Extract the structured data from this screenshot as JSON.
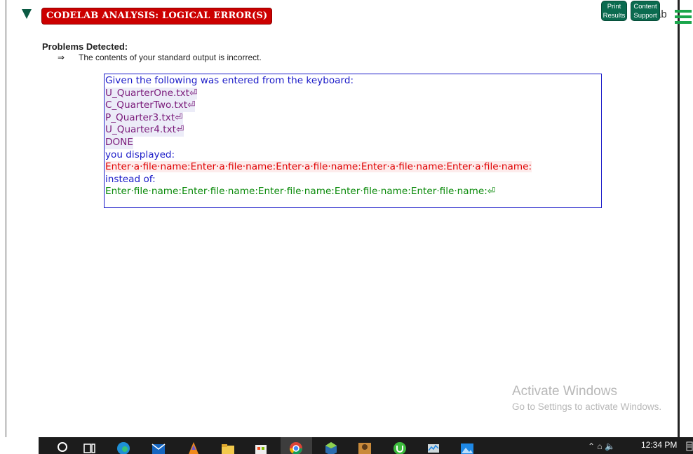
{
  "header": {
    "banner_label": "CODELAB ANALYSIS: LOGICAL ERROR(S)",
    "print_results_line1": "Print",
    "print_results_line2": "Results",
    "content_support_line1": "Content",
    "content_support_line2": "Support",
    "behind_text": "ab"
  },
  "problems": {
    "heading": "Problems Detected:",
    "arrow": "⇒",
    "items": [
      "The contents of your standard output is incorrect."
    ]
  },
  "output": {
    "intro": "Given the following was entered from the keyboard:",
    "inputs": [
      "U_QuarterOne.txt⏎",
      "C_QuarterTwo.txt⏎",
      "P_Quarter3.txt⏎",
      "U_Quarter4.txt⏎",
      "DONE"
    ],
    "displayed_label": "you displayed:",
    "displayed": "Enter·a·file·name:Enter·a·file·name:Enter·a·file·name:Enter·a·file·name:Enter·a·file·name:",
    "instead_label": "instead of:",
    "expected": "Enter·file·name:Enter·file·name:Enter·file·name:Enter·file·name:Enter·file·name:⏎"
  },
  "watermark": {
    "title": "Activate Windows",
    "subtitle": "Go to Settings to activate Windows."
  },
  "taskbar": {
    "clock": "12:34 PM",
    "tray_icons": [
      "chevron-up-icon",
      "network-icon",
      "volume-icon"
    ]
  },
  "colors": {
    "banner": "#cc0000",
    "button": "#0b6b4f",
    "input_text": "#7a1a7a",
    "displayed_text": "#e00000",
    "expected_text": "#0a8a0a",
    "label_text": "#1a1ac8"
  }
}
